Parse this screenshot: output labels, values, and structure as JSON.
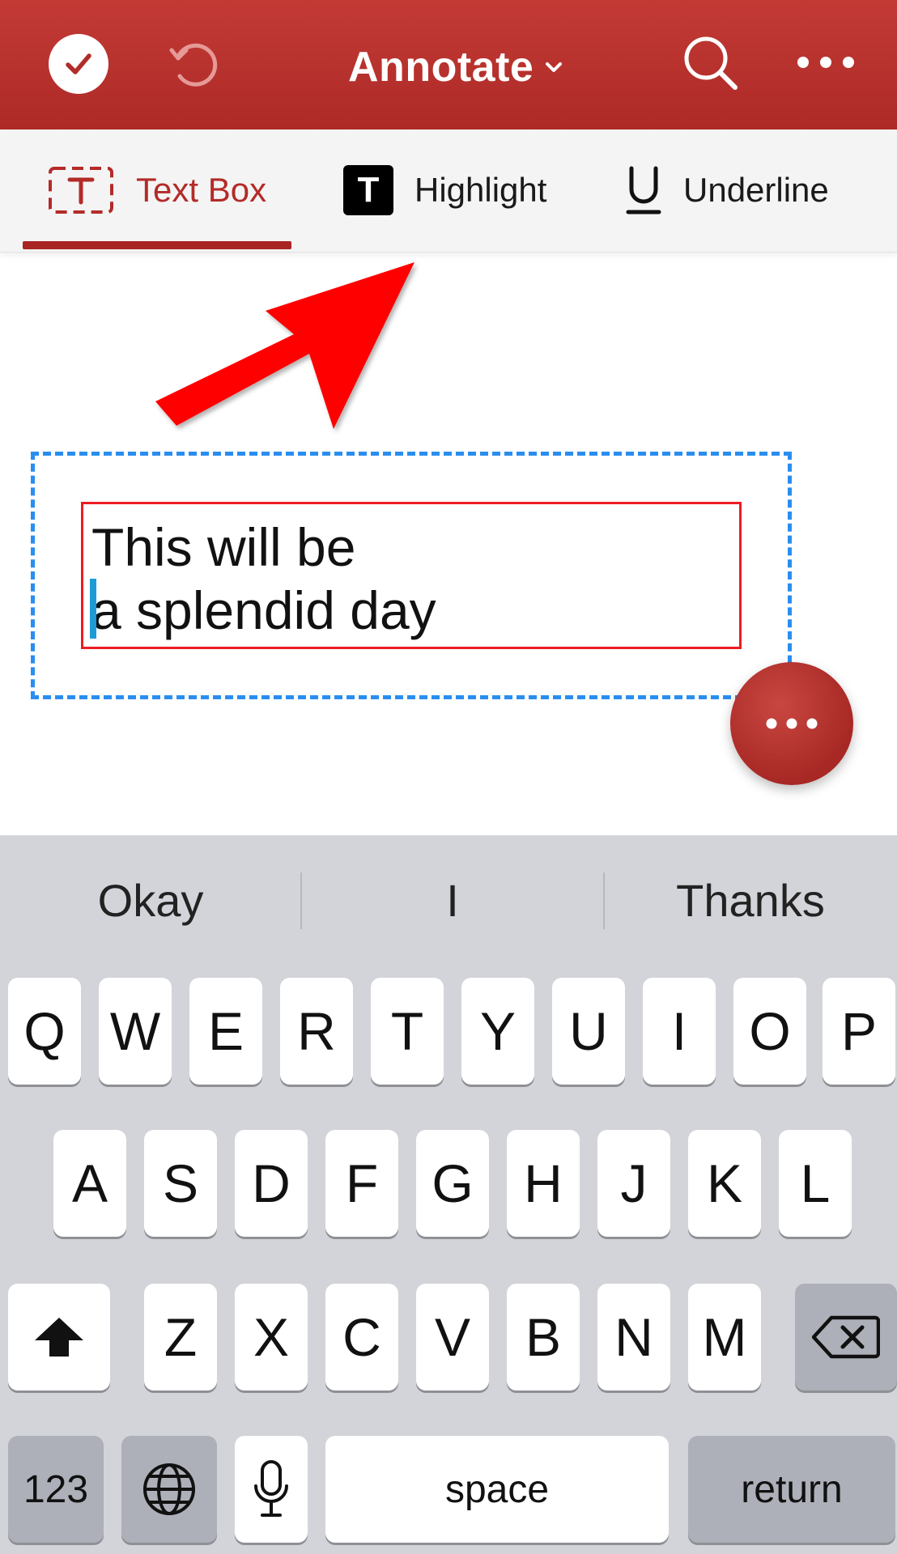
{
  "appbar": {
    "title": "Annotate",
    "done_icon": "checkmark-icon",
    "undo_icon": "undo-icon",
    "search_icon": "search-icon",
    "more_icon": "more-icon",
    "bar_color": "#b12d29"
  },
  "tools": {
    "active": "Text Box",
    "items": [
      {
        "label": "Text Box",
        "icon": "textbox-icon"
      },
      {
        "label": "Highlight",
        "icon": "highlight-icon"
      },
      {
        "label": "Underline",
        "icon": "underline-icon"
      }
    ],
    "highlight_glyph": "T",
    "underline_glyph": "U",
    "accent_color": "#b32b28"
  },
  "annotation": {
    "lines": [
      "This will be",
      "a splendid day"
    ],
    "arrow_color": "#ff0000",
    "frame_color": "#ee1c23",
    "selection_color": "#2a8ef0"
  },
  "keyboard": {
    "suggestions": [
      "Okay",
      "I",
      "Thanks"
    ],
    "row1": [
      "Q",
      "W",
      "E",
      "R",
      "T",
      "Y",
      "U",
      "I",
      "O",
      "P"
    ],
    "row2": [
      "A",
      "S",
      "D",
      "F",
      "G",
      "H",
      "J",
      "K",
      "L"
    ],
    "row3": [
      "Z",
      "X",
      "C",
      "V",
      "B",
      "N",
      "M"
    ],
    "numbers_label": "123",
    "space_label": "space",
    "return_label": "return"
  }
}
